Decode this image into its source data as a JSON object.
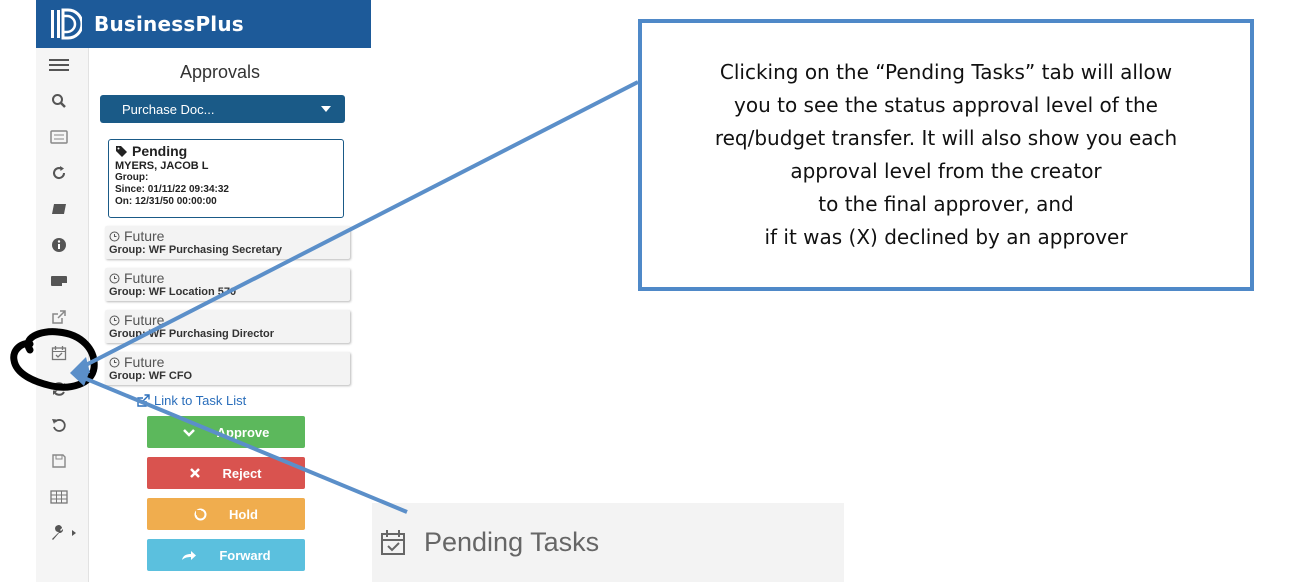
{
  "header": {
    "brand": "BusinessPlus"
  },
  "rail": {
    "icons": [
      "menu-icon",
      "search-icon",
      "keyboard-icon",
      "refresh-icon",
      "book-icon",
      "info-icon",
      "credit-card-icon",
      "external-link-icon",
      "calendar-check-icon",
      "sync-icon",
      "undo-icon",
      "save-icon",
      "table-icon",
      "wrench-icon"
    ]
  },
  "approvals": {
    "title": "Approvals",
    "select_value": "Purchase Doc...",
    "pending": {
      "status": "Pending",
      "name": "MYERS, JACOB L",
      "group": "Group:",
      "since": "Since: 01/11/22 09:34:32",
      "on": "On: 12/31/50 00:00:00"
    },
    "future": [
      {
        "status": "Future",
        "group": "Group: WF Purchasing Secretary"
      },
      {
        "status": "Future",
        "group": "Group: WF Location 570"
      },
      {
        "status": "Future",
        "group": "Group: WF Purchasing Director"
      },
      {
        "status": "Future",
        "group": "Group: WF CFO"
      }
    ],
    "link": "Link to Task List",
    "buttons": {
      "approve": "Approve",
      "reject": "Reject",
      "hold": "Hold",
      "forward": "Forward"
    }
  },
  "callout": {
    "text": "Clicking on the “Pending Tasks” tab will allow\nyou to see the status approval level of the\nreq/budget transfer. It will also show you each\napproval level from the creator\nto the final approver, and\nif it was (X) declined by an approver"
  },
  "zoom": {
    "label": "Pending Tasks"
  },
  "colors": {
    "header_blue": "#1d5a99",
    "select_blue": "#1a5a87",
    "approve": "#5cb85c",
    "reject": "#d9534f",
    "hold": "#f0ad4e",
    "forward": "#5bc0de",
    "callout_border": "#4f89c8",
    "arrow": "#5b8fc9"
  }
}
